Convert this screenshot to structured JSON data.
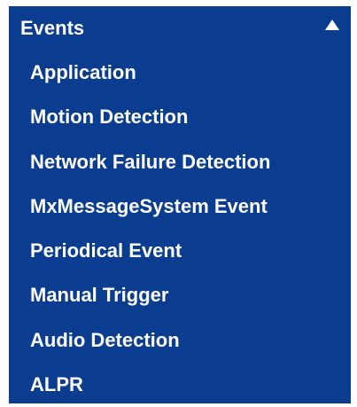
{
  "panel": {
    "title": "Events",
    "collapse_icon": "triangle-up-icon",
    "background_color": "#0a3d8f",
    "text_color": "#ffffff"
  },
  "items": [
    {
      "label": "Application"
    },
    {
      "label": "Motion Detection"
    },
    {
      "label": "Network Failure Detection"
    },
    {
      "label": "MxMessageSystem Event"
    },
    {
      "label": "Periodical Event"
    },
    {
      "label": "Manual Trigger"
    },
    {
      "label": "Audio Detection"
    },
    {
      "label": "ALPR"
    }
  ]
}
